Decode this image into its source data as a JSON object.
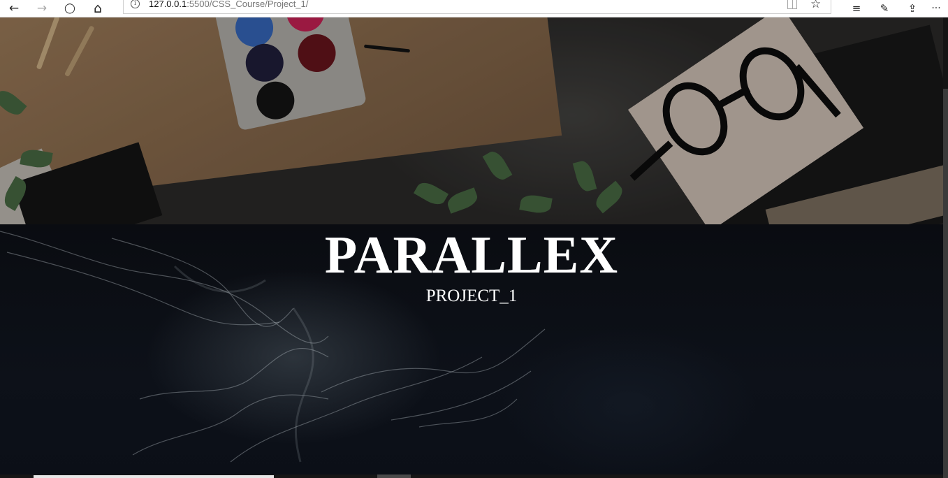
{
  "browser": {
    "url_host": "127.0.0.1",
    "url_rest": ":5500/CSS_Course/Project_1/",
    "icons": {
      "back": "arrow-left-icon",
      "forward": "arrow-right-icon",
      "refresh": "refresh-icon",
      "home": "home-icon",
      "site_info": "info-icon",
      "reading_view": "reading-view-icon",
      "favorite": "star-icon",
      "favorites_hub": "favorites-list-icon",
      "annotate": "pen-icon",
      "share": "share-icon",
      "more": "more-icon"
    },
    "glyphs": {
      "back": "←",
      "forward": "→",
      "refresh": "◯",
      "home": "⌂",
      "info": "i",
      "star": "☆",
      "favorites": "≡",
      "annotate": "✎",
      "share": "⇪",
      "more": "···"
    }
  },
  "page": {
    "hero_title": "PARALLEX",
    "hero_subtitle": "PROJECT_1",
    "colors": {
      "hero_background": "#0b0f17",
      "text": "#ffffff"
    }
  }
}
